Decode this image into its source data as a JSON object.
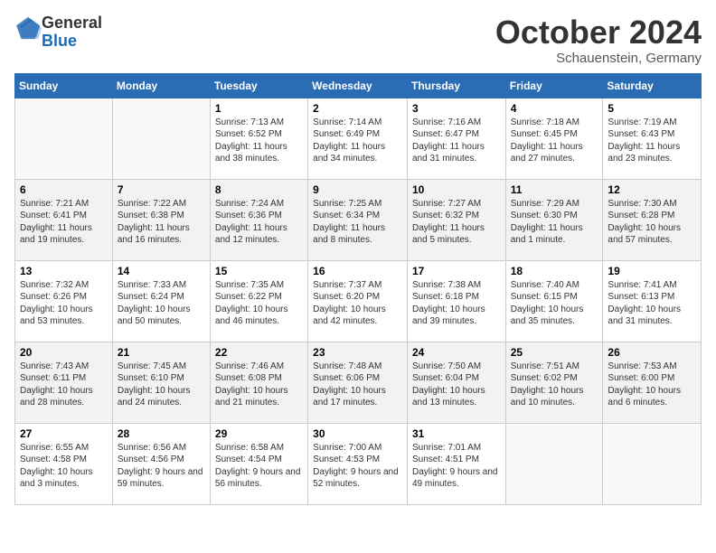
{
  "logo": {
    "general": "General",
    "blue": "Blue"
  },
  "title": "October 2024",
  "subtitle": "Schauenstein, Germany",
  "days_header": [
    "Sunday",
    "Monday",
    "Tuesday",
    "Wednesday",
    "Thursday",
    "Friday",
    "Saturday"
  ],
  "weeks": [
    [
      {
        "day": "",
        "info": ""
      },
      {
        "day": "",
        "info": ""
      },
      {
        "day": "1",
        "info": "Sunrise: 7:13 AM\nSunset: 6:52 PM\nDaylight: 11 hours and 38 minutes."
      },
      {
        "day": "2",
        "info": "Sunrise: 7:14 AM\nSunset: 6:49 PM\nDaylight: 11 hours and 34 minutes."
      },
      {
        "day": "3",
        "info": "Sunrise: 7:16 AM\nSunset: 6:47 PM\nDaylight: 11 hours and 31 minutes."
      },
      {
        "day": "4",
        "info": "Sunrise: 7:18 AM\nSunset: 6:45 PM\nDaylight: 11 hours and 27 minutes."
      },
      {
        "day": "5",
        "info": "Sunrise: 7:19 AM\nSunset: 6:43 PM\nDaylight: 11 hours and 23 minutes."
      }
    ],
    [
      {
        "day": "6",
        "info": "Sunrise: 7:21 AM\nSunset: 6:41 PM\nDaylight: 11 hours and 19 minutes."
      },
      {
        "day": "7",
        "info": "Sunrise: 7:22 AM\nSunset: 6:38 PM\nDaylight: 11 hours and 16 minutes."
      },
      {
        "day": "8",
        "info": "Sunrise: 7:24 AM\nSunset: 6:36 PM\nDaylight: 11 hours and 12 minutes."
      },
      {
        "day": "9",
        "info": "Sunrise: 7:25 AM\nSunset: 6:34 PM\nDaylight: 11 hours and 8 minutes."
      },
      {
        "day": "10",
        "info": "Sunrise: 7:27 AM\nSunset: 6:32 PM\nDaylight: 11 hours and 5 minutes."
      },
      {
        "day": "11",
        "info": "Sunrise: 7:29 AM\nSunset: 6:30 PM\nDaylight: 11 hours and 1 minute."
      },
      {
        "day": "12",
        "info": "Sunrise: 7:30 AM\nSunset: 6:28 PM\nDaylight: 10 hours and 57 minutes."
      }
    ],
    [
      {
        "day": "13",
        "info": "Sunrise: 7:32 AM\nSunset: 6:26 PM\nDaylight: 10 hours and 53 minutes."
      },
      {
        "day": "14",
        "info": "Sunrise: 7:33 AM\nSunset: 6:24 PM\nDaylight: 10 hours and 50 minutes."
      },
      {
        "day": "15",
        "info": "Sunrise: 7:35 AM\nSunset: 6:22 PM\nDaylight: 10 hours and 46 minutes."
      },
      {
        "day": "16",
        "info": "Sunrise: 7:37 AM\nSunset: 6:20 PM\nDaylight: 10 hours and 42 minutes."
      },
      {
        "day": "17",
        "info": "Sunrise: 7:38 AM\nSunset: 6:18 PM\nDaylight: 10 hours and 39 minutes."
      },
      {
        "day": "18",
        "info": "Sunrise: 7:40 AM\nSunset: 6:15 PM\nDaylight: 10 hours and 35 minutes."
      },
      {
        "day": "19",
        "info": "Sunrise: 7:41 AM\nSunset: 6:13 PM\nDaylight: 10 hours and 31 minutes."
      }
    ],
    [
      {
        "day": "20",
        "info": "Sunrise: 7:43 AM\nSunset: 6:11 PM\nDaylight: 10 hours and 28 minutes."
      },
      {
        "day": "21",
        "info": "Sunrise: 7:45 AM\nSunset: 6:10 PM\nDaylight: 10 hours and 24 minutes."
      },
      {
        "day": "22",
        "info": "Sunrise: 7:46 AM\nSunset: 6:08 PM\nDaylight: 10 hours and 21 minutes."
      },
      {
        "day": "23",
        "info": "Sunrise: 7:48 AM\nSunset: 6:06 PM\nDaylight: 10 hours and 17 minutes."
      },
      {
        "day": "24",
        "info": "Sunrise: 7:50 AM\nSunset: 6:04 PM\nDaylight: 10 hours and 13 minutes."
      },
      {
        "day": "25",
        "info": "Sunrise: 7:51 AM\nSunset: 6:02 PM\nDaylight: 10 hours and 10 minutes."
      },
      {
        "day": "26",
        "info": "Sunrise: 7:53 AM\nSunset: 6:00 PM\nDaylight: 10 hours and 6 minutes."
      }
    ],
    [
      {
        "day": "27",
        "info": "Sunrise: 6:55 AM\nSunset: 4:58 PM\nDaylight: 10 hours and 3 minutes."
      },
      {
        "day": "28",
        "info": "Sunrise: 6:56 AM\nSunset: 4:56 PM\nDaylight: 9 hours and 59 minutes."
      },
      {
        "day": "29",
        "info": "Sunrise: 6:58 AM\nSunset: 4:54 PM\nDaylight: 9 hours and 56 minutes."
      },
      {
        "day": "30",
        "info": "Sunrise: 7:00 AM\nSunset: 4:53 PM\nDaylight: 9 hours and 52 minutes."
      },
      {
        "day": "31",
        "info": "Sunrise: 7:01 AM\nSunset: 4:51 PM\nDaylight: 9 hours and 49 minutes."
      },
      {
        "day": "",
        "info": ""
      },
      {
        "day": "",
        "info": ""
      }
    ]
  ]
}
